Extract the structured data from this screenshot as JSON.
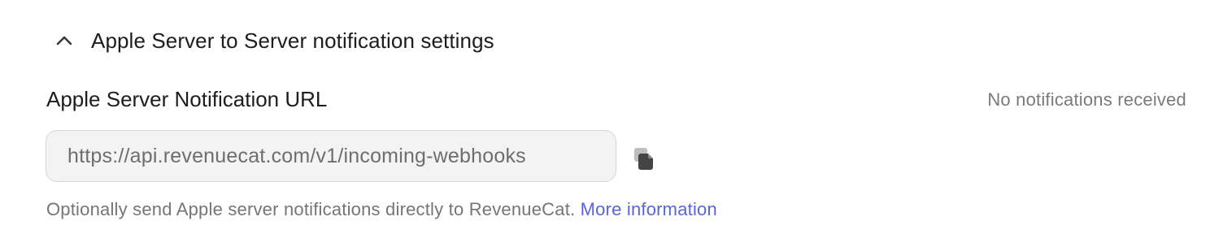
{
  "section": {
    "title": "Apple Server to Server notification settings",
    "expanded": true,
    "toggle_icon": "chevron-up-icon"
  },
  "field": {
    "label": "Apple Server Notification URL",
    "status": "No notifications received",
    "value": "https://api.revenuecat.com/v1/incoming-webhooks",
    "copy_icon": "copy-icon"
  },
  "help": {
    "text": "Optionally send Apple server notifications directly to RevenueCat.",
    "link_label": "More information"
  },
  "colors": {
    "link": "#5865d6",
    "muted_text": "#757575",
    "input_background": "#f3f3f3"
  }
}
